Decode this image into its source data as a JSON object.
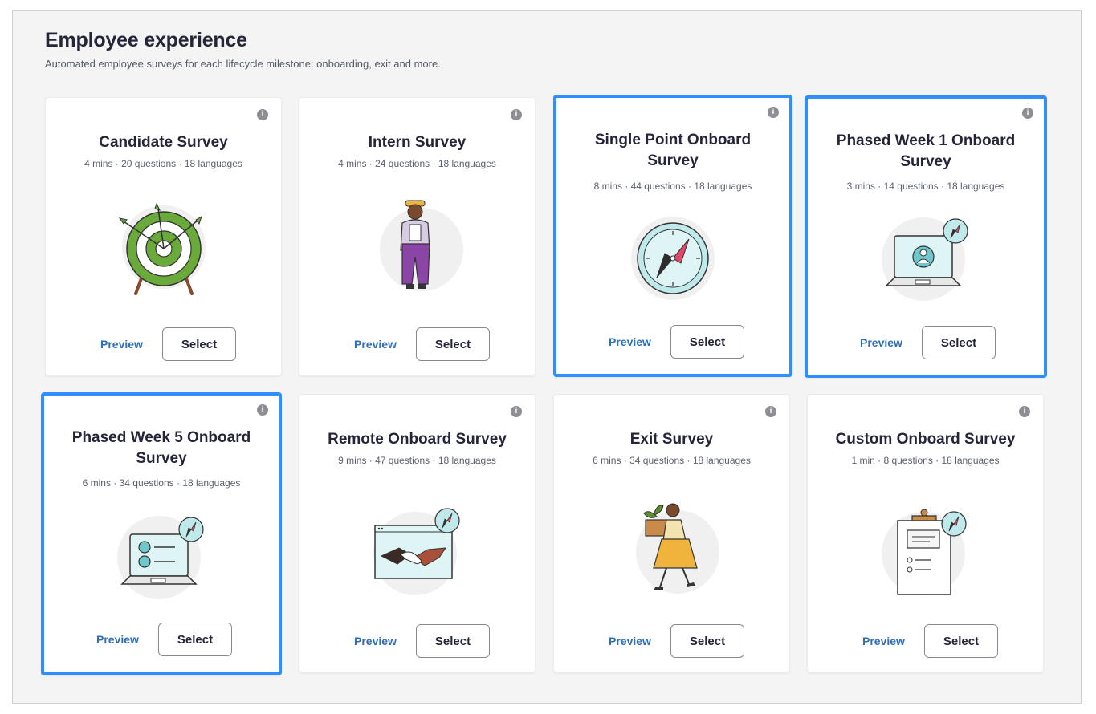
{
  "header": {
    "title": "Employee experience",
    "subtitle": "Automated employee surveys for each lifecycle milestone: onboarding, exit and more."
  },
  "cards": [
    {
      "name": "Candidate Survey",
      "meta": "4 mins · 20 questions · 18 languages",
      "icon": "target-icon",
      "selected": false,
      "preview_label": "Preview",
      "select_label": "Select",
      "info_glyph": "i"
    },
    {
      "name": "Intern Survey",
      "meta": "4 mins · 24 questions · 18 languages",
      "icon": "intern-person-icon",
      "selected": false,
      "preview_label": "Preview",
      "select_label": "Select",
      "info_glyph": "i"
    },
    {
      "name": "Single Point Onboard Survey",
      "meta": "8 mins · 44 questions · 18 languages",
      "icon": "compass-icon",
      "selected": true,
      "preview_label": "Preview",
      "select_label": "Select",
      "info_glyph": "i"
    },
    {
      "name": "Phased Week 1 Onboard Survey",
      "meta": "3 mins · 14 questions · 18 languages",
      "icon": "laptop-user-icon",
      "selected": true,
      "preview_label": "Preview",
      "select_label": "Select",
      "info_glyph": "i"
    },
    {
      "name": "Phased Week 5 Onboard Survey",
      "meta": "6 mins · 34 questions · 18 languages",
      "icon": "laptop-list-icon",
      "selected": true,
      "preview_label": "Preview",
      "select_label": "Select",
      "info_glyph": "i"
    },
    {
      "name": "Remote Onboard Survey",
      "meta": "9 mins · 47 questions · 18 languages",
      "icon": "handshake-icon",
      "selected": false,
      "preview_label": "Preview",
      "select_label": "Select",
      "info_glyph": "i"
    },
    {
      "name": "Exit Survey",
      "meta": "6 mins · 34 questions · 18 languages",
      "icon": "person-carrying-box-icon",
      "selected": false,
      "preview_label": "Preview",
      "select_label": "Select",
      "info_glyph": "i"
    },
    {
      "name": "Custom Onboard Survey",
      "meta": "1 min · 8 questions · 18 languages",
      "icon": "clipboard-icon",
      "selected": false,
      "preview_label": "Preview",
      "select_label": "Select",
      "info_glyph": "i"
    }
  ],
  "colors": {
    "selected_border": "#2f8fff",
    "link": "#2e6fb7",
    "target_green": "#6aaa3a",
    "teal": "#7ccfd2",
    "pink": "#e0476a",
    "purple": "#8a45a6",
    "gold": "#f0b43c",
    "background": "#f4f4f4"
  }
}
